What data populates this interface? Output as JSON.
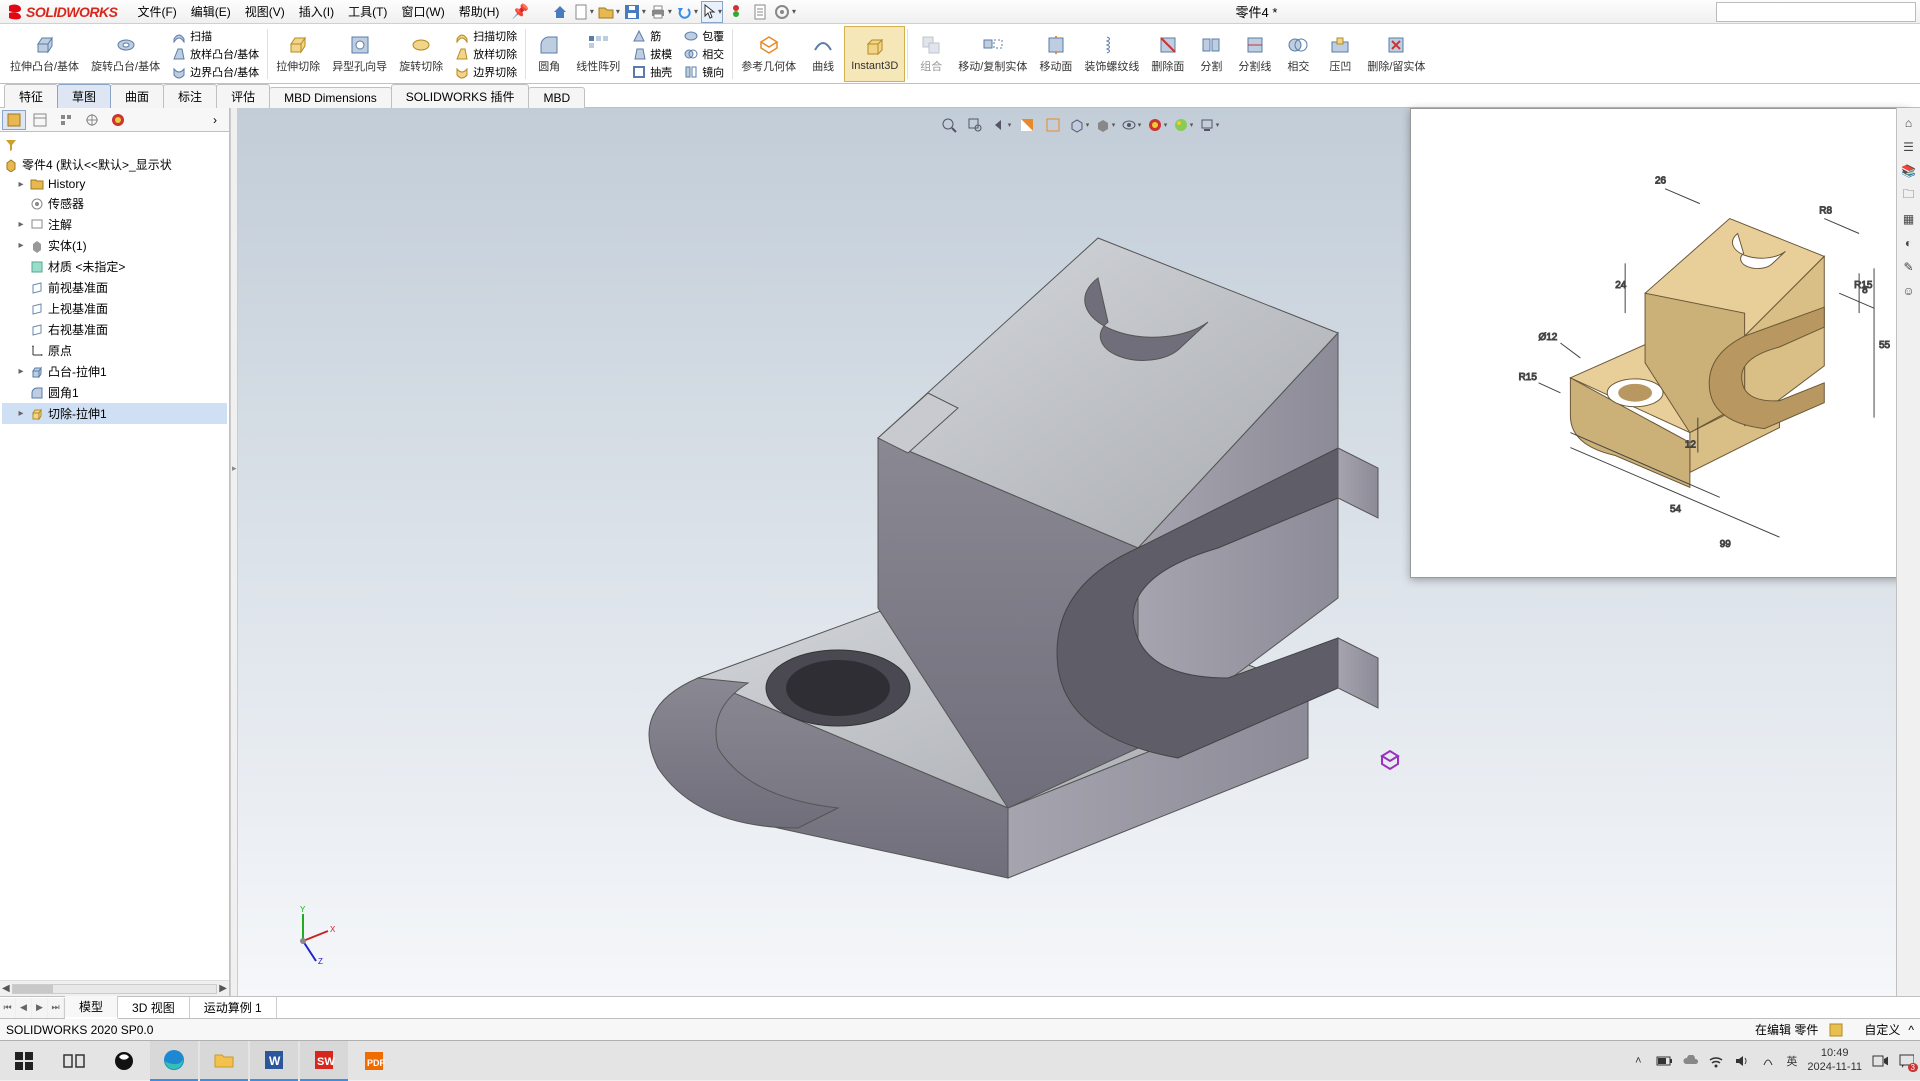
{
  "app": {
    "brand": "SOLIDWORKS"
  },
  "menu": {
    "file": "文件(F)",
    "edit": "编辑(E)",
    "view": "视图(V)",
    "insert": "插入(I)",
    "tools": "工具(T)",
    "window": "窗口(W)",
    "help": "帮助(H)"
  },
  "document_title": "零件4 *",
  "ribbon": {
    "extrude": "拉伸凸台/基体",
    "revolve": "旋转凸台/基体",
    "sweep": "扫描",
    "loft": "放样凸台/基体",
    "boundary": "边界凸台/基体",
    "extrude_cut": "拉伸切除",
    "hole": "异型孔向导",
    "revolve_cut": "旋转切除",
    "sweep_cut": "扫描切除",
    "loft_cut": "放样切除",
    "boundary_cut": "边界切除",
    "fillet": "圆角",
    "linear": "线性阵列",
    "rib": "筋",
    "draft": "拔模",
    "shell": "抽壳",
    "wrap": "包覆",
    "intersect2": "相交",
    "mirror": "镜向",
    "ref_geo": "参考几何体",
    "curve": "曲线",
    "instant3d": "Instant3D",
    "combine": "组合",
    "move_copy": "移动/复制实体",
    "move_face": "移动面",
    "thread": "装饰螺纹线",
    "delete_face": "删除面",
    "split": "分割",
    "split_line": "分割线",
    "intersect": "相交",
    "indent": "压凹",
    "delete_keep": "删除/留实体"
  },
  "cmd_tabs": {
    "features": "特征",
    "sketch": "草图",
    "surfaces": "曲面",
    "annotate": "标注",
    "evaluate": "评估",
    "mbd_dim": "MBD Dimensions",
    "sw_plugins": "SOLIDWORKS 插件",
    "mbd": "MBD"
  },
  "tree": {
    "root": "零件4  (默认<<默认>_显示状",
    "history": "History",
    "sensors": "传感器",
    "annotations": "注解",
    "solid_bodies": "实体(1)",
    "material": "材质 <未指定>",
    "front": "前视基准面",
    "top": "上视基准面",
    "right": "右视基准面",
    "origin": "原点",
    "boss1": "凸台-拉伸1",
    "fillet1": "圆角1",
    "cut1": "切除-拉伸1",
    "filter_tool": "▽"
  },
  "bottom_tabs": {
    "model": "模型",
    "view3d": "3D 视图",
    "motion1": "运动算例 1"
  },
  "status": {
    "version": "SOLIDWORKS 2020 SP0.0",
    "editing": "在编辑 零件",
    "custom": "自定义"
  },
  "system": {
    "time": "10:49",
    "date": "2024-11-11",
    "ime1": "英",
    "badge": "3"
  },
  "tray_icons": {
    "up": "^",
    "battery": "▭",
    "cloud": "☁",
    "wifi": "⌔",
    "vol": "🔊",
    "link": "𝄞",
    "net": "▦"
  }
}
